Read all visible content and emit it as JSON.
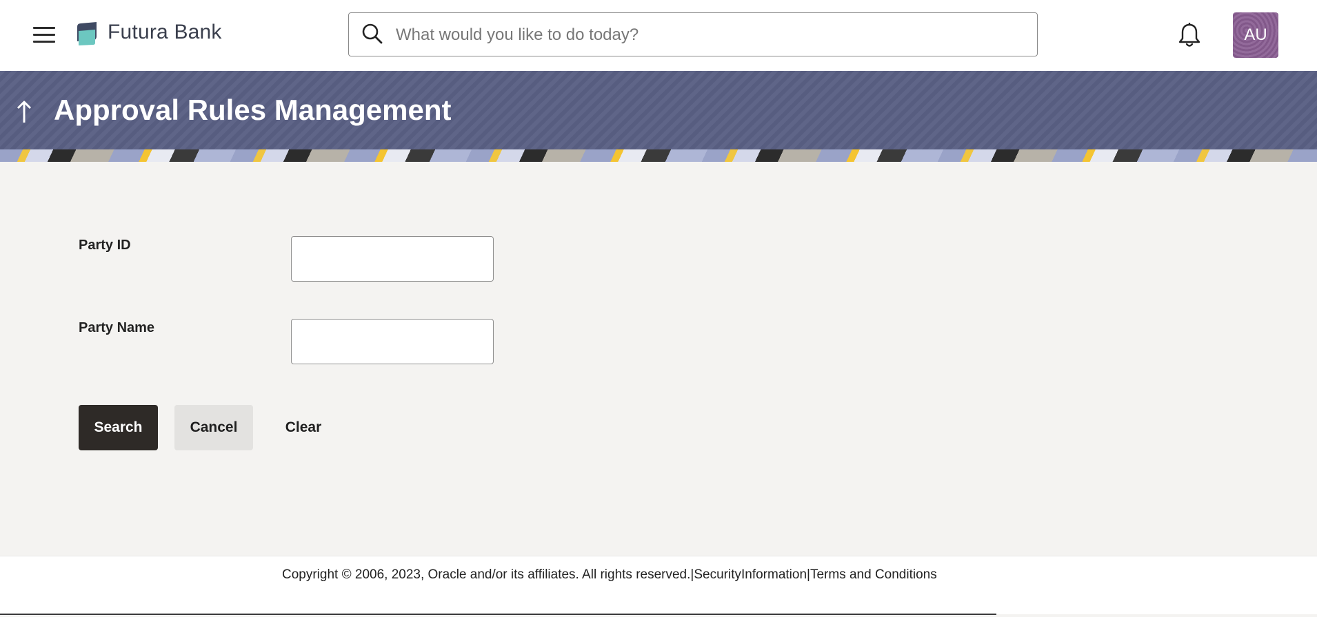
{
  "header": {
    "brand_name": "Futura Bank",
    "search": {
      "placeholder": "What would you like to do today?",
      "value": ""
    },
    "avatar_initials": "AU"
  },
  "page": {
    "title": "Approval Rules Management"
  },
  "form": {
    "party_id": {
      "label": "Party ID",
      "value": ""
    },
    "party_name": {
      "label": "Party Name",
      "value": ""
    }
  },
  "actions": {
    "search_label": "Search",
    "cancel_label": "Cancel",
    "clear_label": "Clear"
  },
  "footer": {
    "copyright": "Copyright © 2006, 2023, Oracle and/or its affiliates. All rights reserved.",
    "sep1": "|",
    "security_link": "SecurityInformation",
    "sep2": "|",
    "terms_link": "Terms and Conditions"
  },
  "colors": {
    "banner": "#5a6084",
    "primary_button": "#2e2a27",
    "secondary_button": "#e3e2e0",
    "avatar": "#8a5e93",
    "page_background": "#f4f3f1"
  },
  "icons": [
    "menu-icon",
    "bank-logo-icon",
    "search-icon",
    "bell-icon",
    "back-arrow-icon"
  ]
}
